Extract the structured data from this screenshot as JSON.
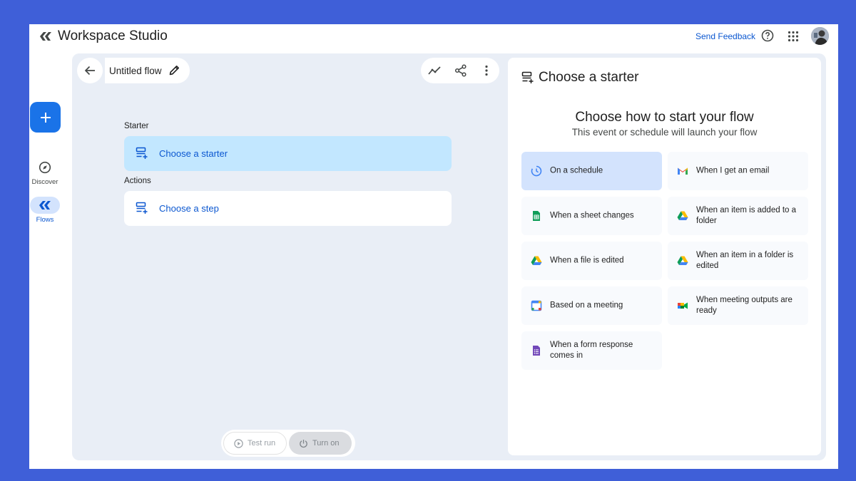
{
  "app": {
    "title": "Workspace Studio",
    "send_feedback": "Send Feedback"
  },
  "rail": {
    "items": [
      {
        "label": "Discover",
        "icon": "compass-icon"
      },
      {
        "label": "Flows",
        "icon": "flows-icon",
        "active": true
      }
    ]
  },
  "editor": {
    "flow_title": "Untitled flow",
    "starter_label": "Starter",
    "starter_card": "Choose a starter",
    "actions_label": "Actions",
    "step_card": "Choose a step",
    "test_run": "Test run",
    "turn_on": "Turn on"
  },
  "panel": {
    "title": "Choose a starter",
    "heading": "Choose how to start your flow",
    "subheading": "This event or schedule will launch your flow",
    "options": [
      {
        "label": "On a schedule",
        "icon": "schedule-icon",
        "selected": true
      },
      {
        "label": "When I get an email",
        "icon": "gmail-icon"
      },
      {
        "label": "When a sheet changes",
        "icon": "sheets-icon"
      },
      {
        "label": "When an item is added to a folder",
        "icon": "drive-icon"
      },
      {
        "label": "When a file is edited",
        "icon": "drive-icon"
      },
      {
        "label": "When an item in a folder is edited",
        "icon": "drive-icon"
      },
      {
        "label": "Based on a meeting",
        "icon": "calendar-icon"
      },
      {
        "label": "When meeting outputs are ready",
        "icon": "meet-icon"
      },
      {
        "label": "When a form response comes in",
        "icon": "forms-icon"
      }
    ]
  },
  "colors": {
    "background": "#3f5fd8",
    "accent": "#0b57d0",
    "selected": "#d3e3fd",
    "starter_card": "#c2e7ff",
    "canvas": "#e9eef6"
  }
}
